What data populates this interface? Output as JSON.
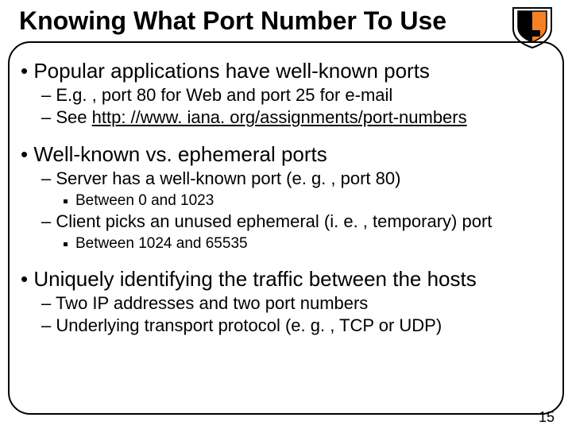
{
  "title": "Knowing What Port Number To Use",
  "logo_alt": "Princeton shield",
  "bullets": {
    "a": {
      "text": "Popular applications have well-known ports",
      "subs": {
        "a1": "E.g. , port 80 for Web and port 25 for e-mail",
        "a2_pre": "See ",
        "a2_link": "http: //www. iana. org/assignments/port-numbers"
      }
    },
    "b": {
      "text": "Well-known vs. ephemeral ports",
      "subs": {
        "b1": "Server has a well-known port (e. g. , port 80)",
        "b1a": "Between 0 and 1023",
        "b2": "Client picks an unused ephemeral (i. e. , temporary) port",
        "b2a": "Between 1024 and 65535"
      }
    },
    "c": {
      "text": "Uniquely identifying the traffic between the hosts",
      "subs": {
        "c1": "Two IP addresses and two port numbers",
        "c2": "Underlying transport protocol (e. g. , TCP or UDP)"
      }
    }
  },
  "page_number": "15"
}
